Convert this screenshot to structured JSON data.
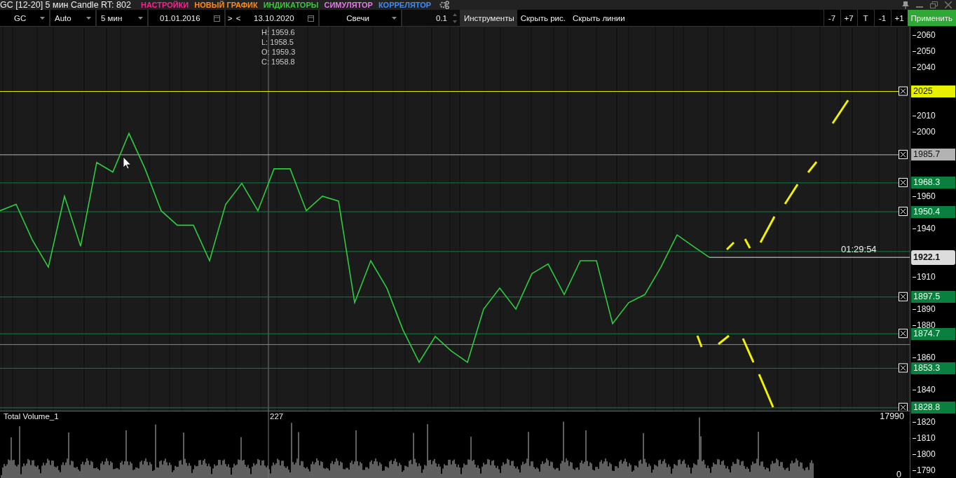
{
  "window": {
    "title": "GC [12-20] 5 мин Candle RT: 802"
  },
  "menu": [
    {
      "label": "НАСТРОЙКИ",
      "color": "#ff1f8f"
    },
    {
      "label": "НОВЫЙ ГРАФИК",
      "color": "#ff8a1a"
    },
    {
      "label": "ИНДИКАТОРЫ",
      "color": "#3ec43e"
    },
    {
      "label": "СИМУЛЯТОР",
      "color": "#e47ae4"
    },
    {
      "label": "КОРРЕЛЯТОР",
      "color": "#3a8dff"
    }
  ],
  "toolbar": {
    "symbol": "GC",
    "scale": "Auto",
    "timeframe": "5 мин",
    "date_from": "01.01.2016",
    "nav_next": ">",
    "nav_prev": "<",
    "date_to": "13.10.2020",
    "chart_type": "Свечи",
    "step": "0.1",
    "tools_button": "Инструменты",
    "hide_drawings": "Скрыть рис.",
    "hide_lines": "Скрыть линии",
    "shift_buttons": [
      "-7",
      "+7",
      "T",
      "-1",
      "+1"
    ],
    "apply_button": "Применить"
  },
  "price_chart": {
    "ohlc": [
      "H: 1959.6",
      "L: 1958.5",
      "O: 1959.3",
      "C: 1958.8"
    ],
    "timer": "01:29:54",
    "chart_data": {
      "type": "line",
      "ylim": [
        1784.8,
        2065.2
      ],
      "categories": [
        null,
        null,
        null,
        null,
        null,
        null,
        null,
        null,
        null,
        null,
        null,
        null,
        null,
        null,
        null,
        null,
        null,
        null,
        null,
        null,
        null,
        null,
        null,
        null,
        null,
        null,
        null,
        null,
        null,
        null,
        null,
        null,
        null,
        null,
        null,
        null,
        null,
        null,
        null,
        null,
        null,
        null,
        null,
        null,
        null
      ],
      "series": [
        {
          "color": "#2ecc40",
          "values": [
            1951,
            1955,
            1933,
            1916,
            1960,
            1929,
            1981,
            1975,
            1999,
            1977,
            1951,
            1942,
            1942,
            1920,
            1955,
            1968,
            1951,
            1977,
            1977,
            1951,
            1960,
            1957,
            1894,
            1920,
            1903,
            1877,
            1857,
            1873,
            1864,
            1857,
            1890,
            1903,
            1890,
            1912,
            1918,
            1899,
            1920,
            1920,
            1881,
            1894,
            1899,
            1916,
            1936,
            1929,
            1922.1
          ]
        }
      ],
      "grid": true,
      "yticks": [
        {
          "value": 2060,
          "label": "2060"
        },
        {
          "value": 2050,
          "label": "2050"
        },
        {
          "value": 2040,
          "label": "2040"
        },
        {
          "value": 2010,
          "label": "2010"
        },
        {
          "value": 2000,
          "label": "2000"
        },
        {
          "value": 1960,
          "label": "1960"
        },
        {
          "value": 1940,
          "label": "1940"
        },
        {
          "value": 1910,
          "label": "1910"
        },
        {
          "value": 1890,
          "label": "1890"
        },
        {
          "value": 1880,
          "label": "1880"
        },
        {
          "value": 1860,
          "label": "1860"
        },
        {
          "value": 1840,
          "label": "1840"
        },
        {
          "value": 1820,
          "label": "1820"
        },
        {
          "value": 1810,
          "label": "1810"
        },
        {
          "value": 1800,
          "label": "1800"
        },
        {
          "value": 1790,
          "label": "1790"
        }
      ],
      "annotations": [
        "1922.1"
      ],
      "ref_lines": [
        {
          "axis": "y",
          "value": 2025,
          "label": "2025",
          "color": "#e8f000"
        },
        {
          "axis": "y",
          "value": 1985.7,
          "label": "1985.7",
          "color": "#b3b3b3"
        },
        {
          "axis": "y",
          "value": 1968.3,
          "label": "1968.3",
          "color": "#0a8040"
        },
        {
          "axis": "y",
          "value": 1950.4,
          "label": "1950.4",
          "color": "#0a8040"
        },
        {
          "axis": "y",
          "value": 1925.7,
          "color": "#0a8040"
        },
        {
          "axis": "y",
          "value": 1897.5,
          "label": "1897.5",
          "color": "#0a8040"
        },
        {
          "axis": "y",
          "value": 1874.7,
          "label": "1874.7",
          "color": "#0a8040"
        },
        {
          "axis": "y",
          "value": 1868,
          "color": "#888888"
        },
        {
          "axis": "y",
          "value": 1853.3,
          "label": "1853.3",
          "color": "#0a8040"
        },
        {
          "axis": "y",
          "value": 1828.8,
          "label": "1828.8",
          "color": "#0a8040"
        }
      ]
    }
  },
  "volume_pane": {
    "title": "Total Volume_1",
    "crosshair_value": "227",
    "max_label": "17990",
    "min_label": "0"
  }
}
